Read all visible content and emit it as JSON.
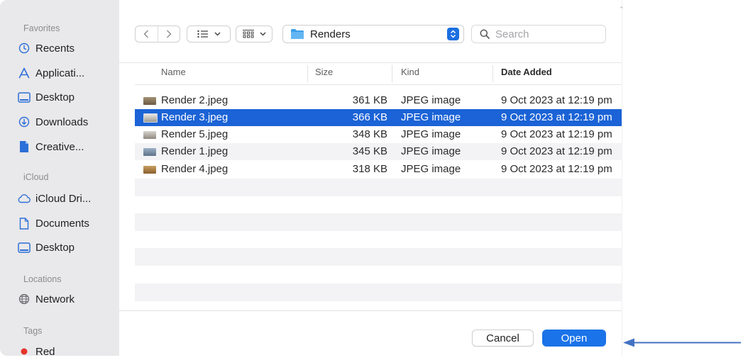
{
  "sidebar": {
    "sections": [
      {
        "heading": "Favorites",
        "items": [
          {
            "label": "Recents",
            "icon": "clock-icon"
          },
          {
            "label": "Applicati...",
            "icon": "applications-icon"
          },
          {
            "label": "Desktop",
            "icon": "desktop-icon"
          },
          {
            "label": "Downloads",
            "icon": "download-icon"
          },
          {
            "label": "Creative...",
            "icon": "document-icon"
          }
        ]
      },
      {
        "heading": "iCloud",
        "items": [
          {
            "label": "iCloud Dri...",
            "icon": "cloud-icon"
          },
          {
            "label": "Documents",
            "icon": "document-outline-icon"
          },
          {
            "label": "Desktop",
            "icon": "desktop-icon"
          }
        ]
      },
      {
        "heading": "Locations",
        "items": [
          {
            "label": "Network",
            "icon": "globe-icon"
          }
        ]
      },
      {
        "heading": "Tags",
        "items": [
          {
            "label": "Red",
            "icon": "red-tag-dot",
            "color": "#e5342b"
          }
        ]
      }
    ]
  },
  "toolbar": {
    "location": "Renders",
    "search_placeholder": "Search"
  },
  "columns": {
    "name": "Name",
    "size": "Size",
    "kind": "Kind",
    "date": "Date Added"
  },
  "files": [
    {
      "name": "Render 2.jpeg",
      "size": "361 KB",
      "kind": "JPEG image",
      "date": "9 Oct 2023 at 12:19 pm",
      "selected": false
    },
    {
      "name": "Render 3.jpeg",
      "size": "366 KB",
      "kind": "JPEG image",
      "date": "9 Oct 2023 at 12:19 pm",
      "selected": true
    },
    {
      "name": "Render 5.jpeg",
      "size": "348 KB",
      "kind": "JPEG image",
      "date": "9 Oct 2023 at 12:19 pm",
      "selected": false
    },
    {
      "name": "Render 1.jpeg",
      "size": "345 KB",
      "kind": "JPEG image",
      "date": "9 Oct 2023 at 12:19 pm",
      "selected": false
    },
    {
      "name": "Render 4.jpeg",
      "size": "318 KB",
      "kind": "JPEG image",
      "date": "9 Oct 2023 at 12:19 pm",
      "selected": false
    }
  ],
  "buttons": {
    "cancel": "Cancel",
    "open": "Open"
  },
  "colors": {
    "accent": "#1b63d6",
    "arrow": "#4472c4",
    "folder": "#3b9eea"
  }
}
